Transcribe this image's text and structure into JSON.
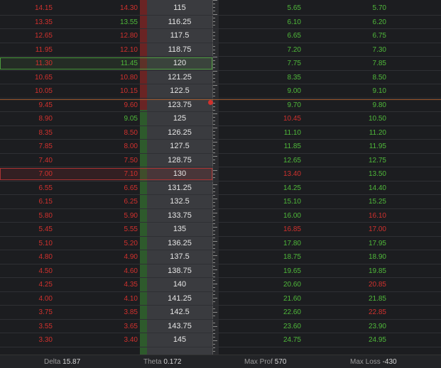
{
  "rows": [
    {
      "put_bid": "14.15",
      "put_ask": "14.30",
      "strike": "115",
      "call_bid": "5.65",
      "call_ask": "5.70",
      "pb": "red",
      "pa": "red",
      "cb": "green",
      "ca": "green"
    },
    {
      "put_bid": "13.35",
      "put_ask": "13.55",
      "strike": "116.25",
      "call_bid": "6.10",
      "call_ask": "6.20",
      "pb": "red",
      "pa": "green",
      "cb": "green",
      "ca": "green"
    },
    {
      "put_bid": "12.65",
      "put_ask": "12.80",
      "strike": "117.5",
      "call_bid": "6.65",
      "call_ask": "6.75",
      "pb": "red",
      "pa": "red",
      "cb": "green",
      "ca": "green"
    },
    {
      "put_bid": "11.95",
      "put_ask": "12.10",
      "strike": "118.75",
      "call_bid": "7.20",
      "call_ask": "7.30",
      "pb": "red",
      "pa": "red",
      "cb": "green",
      "ca": "green"
    },
    {
      "put_bid": "11.30",
      "put_ask": "11.45",
      "strike": "120",
      "call_bid": "7.75",
      "call_ask": "7.85",
      "pb": "red",
      "pa": "green",
      "cb": "green",
      "ca": "green"
    },
    {
      "put_bid": "10.65",
      "put_ask": "10.80",
      "strike": "121.25",
      "call_bid": "8.35",
      "call_ask": "8.50",
      "pb": "red",
      "pa": "red",
      "cb": "green",
      "ca": "green"
    },
    {
      "put_bid": "10.05",
      "put_ask": "10.15",
      "strike": "122.5",
      "call_bid": "9.00",
      "call_ask": "9.10",
      "pb": "red",
      "pa": "red",
      "cb": "green",
      "ca": "green"
    },
    {
      "put_bid": "9.45",
      "put_ask": "9.60",
      "strike": "123.75",
      "call_bid": "9.70",
      "call_ask": "9.80",
      "pb": "red",
      "pa": "red",
      "cb": "green",
      "ca": "green"
    },
    {
      "put_bid": "8.90",
      "put_ask": "9.05",
      "strike": "125",
      "call_bid": "10.45",
      "call_ask": "10.50",
      "pb": "red",
      "pa": "green",
      "cb": "red",
      "ca": "green"
    },
    {
      "put_bid": "8.35",
      "put_ask": "8.50",
      "strike": "126.25",
      "call_bid": "11.10",
      "call_ask": "11.20",
      "pb": "red",
      "pa": "red",
      "cb": "green",
      "ca": "green"
    },
    {
      "put_bid": "7.85",
      "put_ask": "8.00",
      "strike": "127.5",
      "call_bid": "11.85",
      "call_ask": "11.95",
      "pb": "red",
      "pa": "red",
      "cb": "green",
      "ca": "green"
    },
    {
      "put_bid": "7.40",
      "put_ask": "7.50",
      "strike": "128.75",
      "call_bid": "12.65",
      "call_ask": "12.75",
      "pb": "red",
      "pa": "red",
      "cb": "green",
      "ca": "green"
    },
    {
      "put_bid": "7.00",
      "put_ask": "7.10",
      "strike": "130",
      "call_bid": "13.40",
      "call_ask": "13.50",
      "pb": "red",
      "pa": "red",
      "cb": "red",
      "ca": "green"
    },
    {
      "put_bid": "6.55",
      "put_ask": "6.65",
      "strike": "131.25",
      "call_bid": "14.25",
      "call_ask": "14.40",
      "pb": "red",
      "pa": "red",
      "cb": "green",
      "ca": "green"
    },
    {
      "put_bid": "6.15",
      "put_ask": "6.25",
      "strike": "132.5",
      "call_bid": "15.10",
      "call_ask": "15.25",
      "pb": "red",
      "pa": "red",
      "cb": "green",
      "ca": "green"
    },
    {
      "put_bid": "5.80",
      "put_ask": "5.90",
      "strike": "133.75",
      "call_bid": "16.00",
      "call_ask": "16.10",
      "pb": "red",
      "pa": "red",
      "cb": "green",
      "ca": "red"
    },
    {
      "put_bid": "5.45",
      "put_ask": "5.55",
      "strike": "135",
      "call_bid": "16.85",
      "call_ask": "17.00",
      "pb": "red",
      "pa": "red",
      "cb": "red",
      "ca": "red"
    },
    {
      "put_bid": "5.10",
      "put_ask": "5.20",
      "strike": "136.25",
      "call_bid": "17.80",
      "call_ask": "17.95",
      "pb": "red",
      "pa": "red",
      "cb": "green",
      "ca": "green"
    },
    {
      "put_bid": "4.80",
      "put_ask": "4.90",
      "strike": "137.5",
      "call_bid": "18.75",
      "call_ask": "18.90",
      "pb": "red",
      "pa": "red",
      "cb": "green",
      "ca": "green"
    },
    {
      "put_bid": "4.50",
      "put_ask": "4.60",
      "strike": "138.75",
      "call_bid": "19.65",
      "call_ask": "19.85",
      "pb": "red",
      "pa": "red",
      "cb": "green",
      "ca": "green"
    },
    {
      "put_bid": "4.25",
      "put_ask": "4.35",
      "strike": "140",
      "call_bid": "20.60",
      "call_ask": "20.85",
      "pb": "red",
      "pa": "red",
      "cb": "green",
      "ca": "red"
    },
    {
      "put_bid": "4.00",
      "put_ask": "4.10",
      "strike": "141.25",
      "call_bid": "21.60",
      "call_ask": "21.85",
      "pb": "red",
      "pa": "red",
      "cb": "green",
      "ca": "green"
    },
    {
      "put_bid": "3.75",
      "put_ask": "3.85",
      "strike": "142.5",
      "call_bid": "22.60",
      "call_ask": "22.85",
      "pb": "red",
      "pa": "red",
      "cb": "green",
      "ca": "red"
    },
    {
      "put_bid": "3.55",
      "put_ask": "3.65",
      "strike": "143.75",
      "call_bid": "23.60",
      "call_ask": "23.90",
      "pb": "red",
      "pa": "red",
      "cb": "green",
      "ca": "green"
    },
    {
      "put_bid": "3.30",
      "put_ask": "3.40",
      "strike": "145",
      "call_bid": "24.75",
      "call_ask": "24.95",
      "pb": "red",
      "pa": "red",
      "cb": "green",
      "ca": "green"
    }
  ],
  "highlighted_strikes": [
    "120",
    "130"
  ],
  "footer": {
    "delta_label": "Delta",
    "delta_value": "15.87",
    "theta_label": "Theta",
    "theta_value": "0.172",
    "maxprof_label": "Max Prof",
    "maxprof_value": "570",
    "maxloss_label": "Max Loss",
    "maxloss_value": "-430"
  },
  "colors": {
    "red": "#d0312d",
    "green": "#4fb83a",
    "background": "#1c1d20"
  }
}
